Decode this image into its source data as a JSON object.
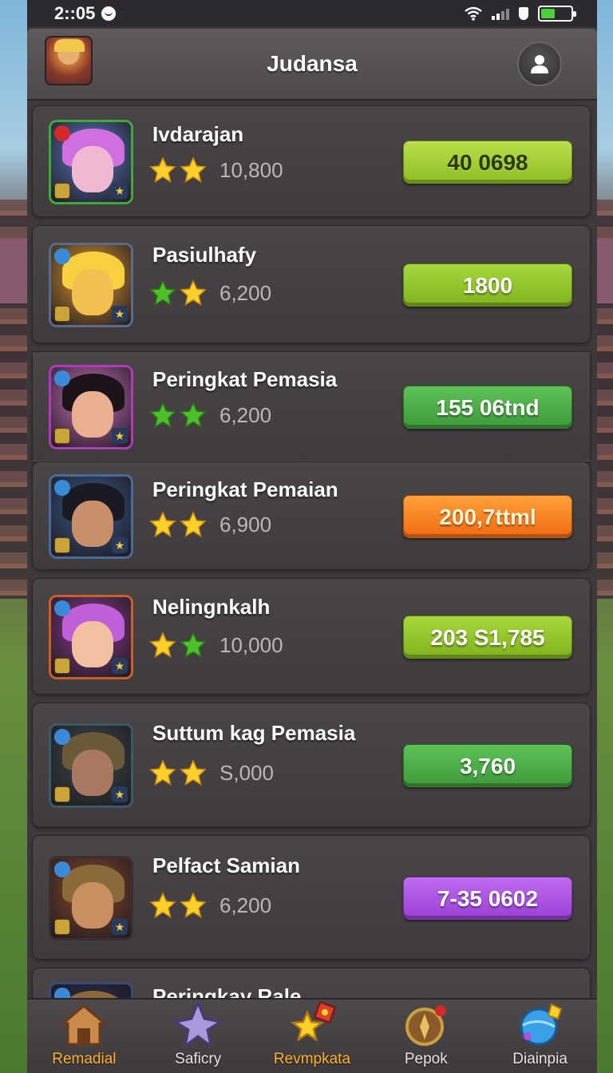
{
  "status_bar": {
    "time": "2::05"
  },
  "header": {
    "title": "Judansa"
  },
  "players": [
    {
      "name": "Ivdarajan",
      "score": "10,800",
      "value": "40 0698",
      "stars": [
        "gold",
        "gold"
      ],
      "button": "btn-lime",
      "frame": "#3ea83a"
    },
    {
      "name": "Pasiulhafy",
      "score": "6,200",
      "value": "1800",
      "stars": [
        "green",
        "gold"
      ],
      "button": "btn-lime2",
      "frame": "#5a6a8a"
    },
    {
      "name": "Peringkat Pemasia",
      "score": "6,200",
      "value": "155 06tnd",
      "stars": [
        "green",
        "green"
      ],
      "button": "btn-green",
      "frame": "#b03ab8"
    },
    {
      "name": "Peringkat Pemaian",
      "score": "6,900",
      "value": "200,7ttml",
      "stars": [
        "gold",
        "gold"
      ],
      "button": "btn-orange",
      "frame": "#4a6a9a"
    },
    {
      "name": "Nelingnkalh",
      "score": "10,000",
      "value": "203 S1,785",
      "stars": [
        "gold",
        "green"
      ],
      "button": "btn-lime2",
      "frame": "#c8602a"
    },
    {
      "name": "Suttum kag Pemasia",
      "score": "S,000",
      "value": "3,760",
      "stars": [
        "gold",
        "gold"
      ],
      "button": "btn-green",
      "frame": "#3a5a6a"
    },
    {
      "name": "Pelfact Samian",
      "score": "6,200",
      "value": "7-35 0602",
      "stars": [
        "gold",
        "gold"
      ],
      "button": "btn-purple",
      "frame": "#3a3034"
    },
    {
      "name": "Peringkay Rale",
      "score": "",
      "value": "",
      "stars": [],
      "button": "btn-lime2",
      "frame": "#3a4a7a"
    }
  ],
  "nav": [
    {
      "label": "Remadial",
      "icon": "house-icon",
      "active": true
    },
    {
      "label": "Saficry",
      "icon": "star-shuriken-icon",
      "active": false
    },
    {
      "label": "Revmpkata",
      "icon": "star-gem-icon",
      "active": true
    },
    {
      "label": "Pepok",
      "icon": "compass-icon",
      "active": false
    },
    {
      "label": "Diainpia",
      "icon": "globe-gem-icon",
      "active": false
    }
  ],
  "colors": {
    "accent": "#ffb02e",
    "panel": "#3e3a3c"
  }
}
